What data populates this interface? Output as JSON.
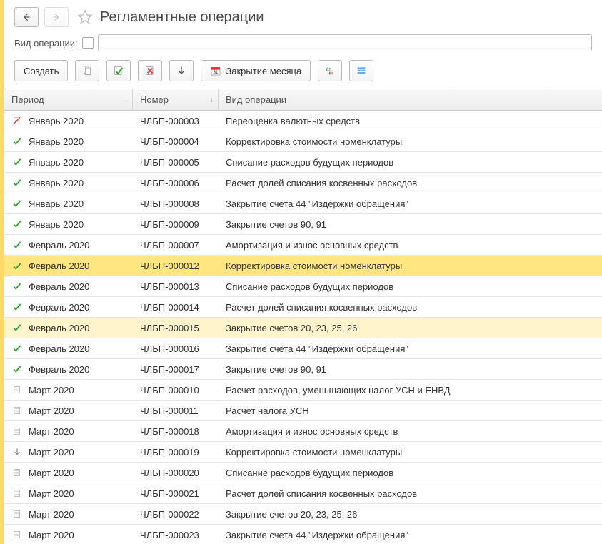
{
  "header": {
    "title": "Регламентные операции"
  },
  "filter": {
    "label": "Вид операции:"
  },
  "toolbar": {
    "create_label": "Создать",
    "close_month_label": "Закрытие месяца"
  },
  "grid": {
    "columns": {
      "period": "Период",
      "number": "Номер",
      "optype": "Вид операции"
    },
    "rows": [
      {
        "status": "cancelled",
        "period": "Январь 2020",
        "number": "ЧЛБП-000003",
        "optype": "Переоценка валютных средств",
        "state": ""
      },
      {
        "status": "ok",
        "period": "Январь 2020",
        "number": "ЧЛБП-000004",
        "optype": "Корректировка стоимости номенклатуры",
        "state": ""
      },
      {
        "status": "ok",
        "period": "Январь 2020",
        "number": "ЧЛБП-000005",
        "optype": "Списание расходов будущих периодов",
        "state": ""
      },
      {
        "status": "ok",
        "period": "Январь 2020",
        "number": "ЧЛБП-000006",
        "optype": "Расчет долей списания косвенных расходов",
        "state": ""
      },
      {
        "status": "ok",
        "period": "Январь 2020",
        "number": "ЧЛБП-000008",
        "optype": "Закрытие счета 44 \"Издержки обращения\"",
        "state": ""
      },
      {
        "status": "ok",
        "period": "Январь 2020",
        "number": "ЧЛБП-000009",
        "optype": "Закрытие счетов 90, 91",
        "state": ""
      },
      {
        "status": "ok",
        "period": "Февраль 2020",
        "number": "ЧЛБП-000007",
        "optype": "Амортизация и износ основных средств",
        "state": ""
      },
      {
        "status": "ok",
        "period": "Февраль 2020",
        "number": "ЧЛБП-000012",
        "optype": "Корректировка стоимости номенклатуры",
        "state": "selected"
      },
      {
        "status": "ok",
        "period": "Февраль 2020",
        "number": "ЧЛБП-000013",
        "optype": "Списание расходов будущих периодов",
        "state": ""
      },
      {
        "status": "ok",
        "period": "Февраль 2020",
        "number": "ЧЛБП-000014",
        "optype": "Расчет долей списания косвенных расходов",
        "state": ""
      },
      {
        "status": "ok",
        "period": "Февраль 2020",
        "number": "ЧЛБП-000015",
        "optype": "Закрытие счетов 20, 23, 25, 26",
        "state": "highlight"
      },
      {
        "status": "ok",
        "period": "Февраль 2020",
        "number": "ЧЛБП-000016",
        "optype": "Закрытие счета 44 \"Издержки обращения\"",
        "state": ""
      },
      {
        "status": "ok",
        "period": "Февраль 2020",
        "number": "ЧЛБП-000017",
        "optype": "Закрытие счетов 90, 91",
        "state": ""
      },
      {
        "status": "draft",
        "period": "Март 2020",
        "number": "ЧЛБП-000010",
        "optype": "Расчет расходов, уменьшающих налог УСН и ЕНВД",
        "state": ""
      },
      {
        "status": "draft",
        "period": "Март 2020",
        "number": "ЧЛБП-000011",
        "optype": "Расчет налога УСН",
        "state": ""
      },
      {
        "status": "draft",
        "period": "Март 2020",
        "number": "ЧЛБП-000018",
        "optype": "Амортизация и износ основных средств",
        "state": ""
      },
      {
        "status": "queued",
        "period": "Март 2020",
        "number": "ЧЛБП-000019",
        "optype": "Корректировка стоимости номенклатуры",
        "state": ""
      },
      {
        "status": "draft",
        "period": "Март 2020",
        "number": "ЧЛБП-000020",
        "optype": "Списание расходов будущих периодов",
        "state": ""
      },
      {
        "status": "draft",
        "period": "Март 2020",
        "number": "ЧЛБП-000021",
        "optype": "Расчет долей списания косвенных расходов",
        "state": ""
      },
      {
        "status": "draft",
        "period": "Март 2020",
        "number": "ЧЛБП-000022",
        "optype": "Закрытие счетов 20, 23, 25, 26",
        "state": ""
      },
      {
        "status": "draft",
        "period": "Март 2020",
        "number": "ЧЛБП-000023",
        "optype": "Закрытие счета 44 \"Издержки обращения\"",
        "state": ""
      }
    ]
  }
}
